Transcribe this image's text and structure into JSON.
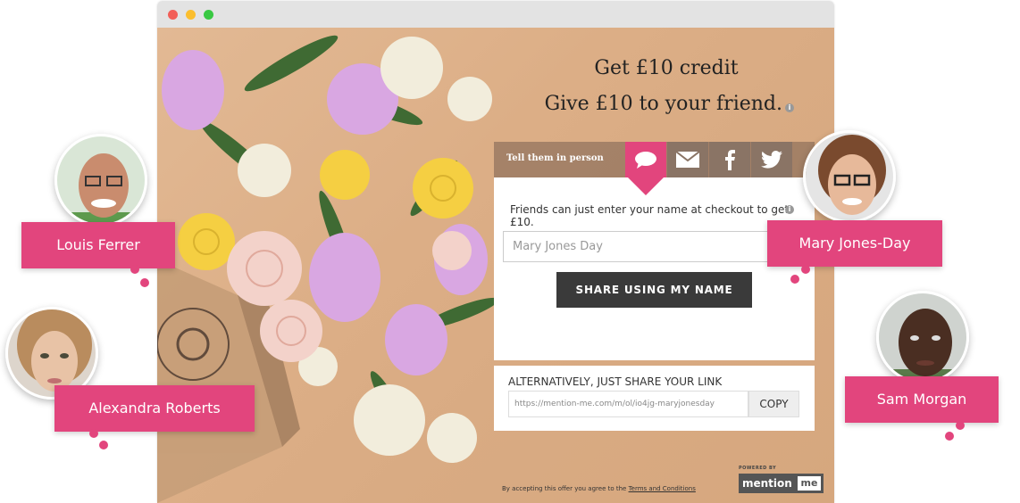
{
  "window": {
    "buttons": [
      "close",
      "minimize",
      "zoom"
    ]
  },
  "offer": {
    "headline": "Get £10 credit",
    "subheadline": "Give £10 to your friend.",
    "info_icon": "i"
  },
  "tabs": {
    "label": "Tell them in person",
    "items": [
      {
        "name": "chat-icon",
        "active": true
      },
      {
        "name": "email-icon",
        "active": false
      },
      {
        "name": "facebook-icon",
        "active": false
      },
      {
        "name": "twitter-icon",
        "active": false
      }
    ]
  },
  "panel": {
    "description": "Friends can just enter your name at checkout to get £10.",
    "name_value": "Mary Jones Day",
    "share_button": "SHARE USING MY NAME"
  },
  "link_panel": {
    "title": "ALTERNATIVELY, JUST SHARE YOUR LINK",
    "link_value": "https://mention-me.com/m/ol/io4jg-maryjonesday",
    "copy_button": "COPY"
  },
  "footer": {
    "terms_prefix": "By accepting this offer you agree to the ",
    "terms_link": "Terms and Conditions",
    "powered_by": "POWERED BY",
    "logo_text": "mention",
    "logo_me": "me"
  },
  "personas": [
    {
      "name": "Louis Ferrer"
    },
    {
      "name": "Alexandra Roberts"
    },
    {
      "name": "Mary Jones-Day"
    },
    {
      "name": "Sam Morgan"
    }
  ],
  "colors": {
    "accent": "#e2457d",
    "button_dark": "#3a3a3a",
    "tab_inactive": "#8a7465"
  }
}
